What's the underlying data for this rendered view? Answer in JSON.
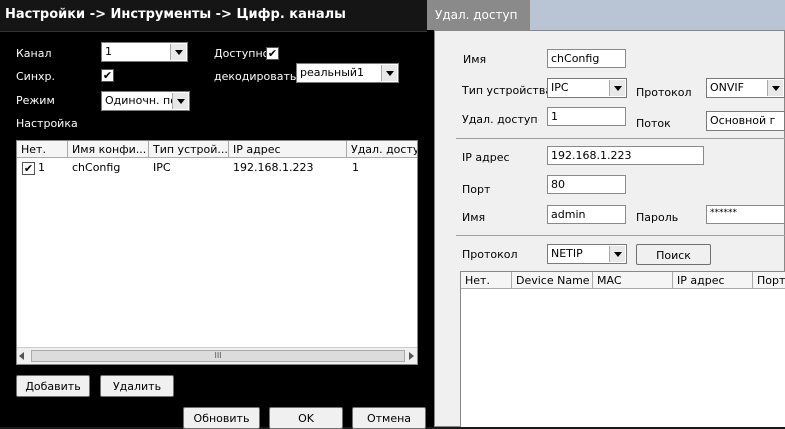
{
  "left": {
    "title": "Настройки -> Инструменты -> Цифр. каналы",
    "channel_label": "Канал",
    "channel_value": "1",
    "available_label": "Доступно",
    "sync_label": "Синхр.",
    "decode_label": "декодировать",
    "decode_value": "реальный1",
    "mode_label": "Режим",
    "mode_value": "Одиночн. под",
    "settings_label": "Настройка",
    "table": {
      "headers": [
        "Нет.",
        "Имя конфи...",
        "Тип устрой...",
        "IP адрес",
        "Удал. доступ"
      ],
      "rows": [
        {
          "num": "1",
          "name": "chConfig",
          "type": "IPC",
          "ip": "192.168.1.223",
          "remote": "1"
        }
      ],
      "scroll_grip": "III"
    },
    "add_button": "Добавить",
    "delete_button": "Удалить",
    "refresh_button": "Обновить",
    "ok_button": "OK",
    "cancel_button": "Отмена"
  },
  "right": {
    "title": "Удал. доступ",
    "name_label": "Имя",
    "name_value": "chConfig",
    "device_type_label": "Тип устройства",
    "device_type_value": "IPC",
    "protocol_label": "Протокол",
    "protocol_value": "ONVIF",
    "remote_label": "Удал. доступ",
    "remote_value": "1",
    "stream_label": "Поток",
    "stream_value": "Основной г",
    "ip_label": "IP адрес",
    "ip_value": "192.168.1.223",
    "port_label": "Порт",
    "port_value": "80",
    "user_label": "Имя",
    "user_value": "admin",
    "password_label": "Пароль",
    "password_value": "******",
    "search_protocol_label": "Протокол",
    "search_protocol_value": "NETIP",
    "search_button": "Поиск",
    "table_headers": [
      "Нет.",
      "Device Name",
      "MAC",
      "IP адрес",
      "Порт"
    ]
  }
}
